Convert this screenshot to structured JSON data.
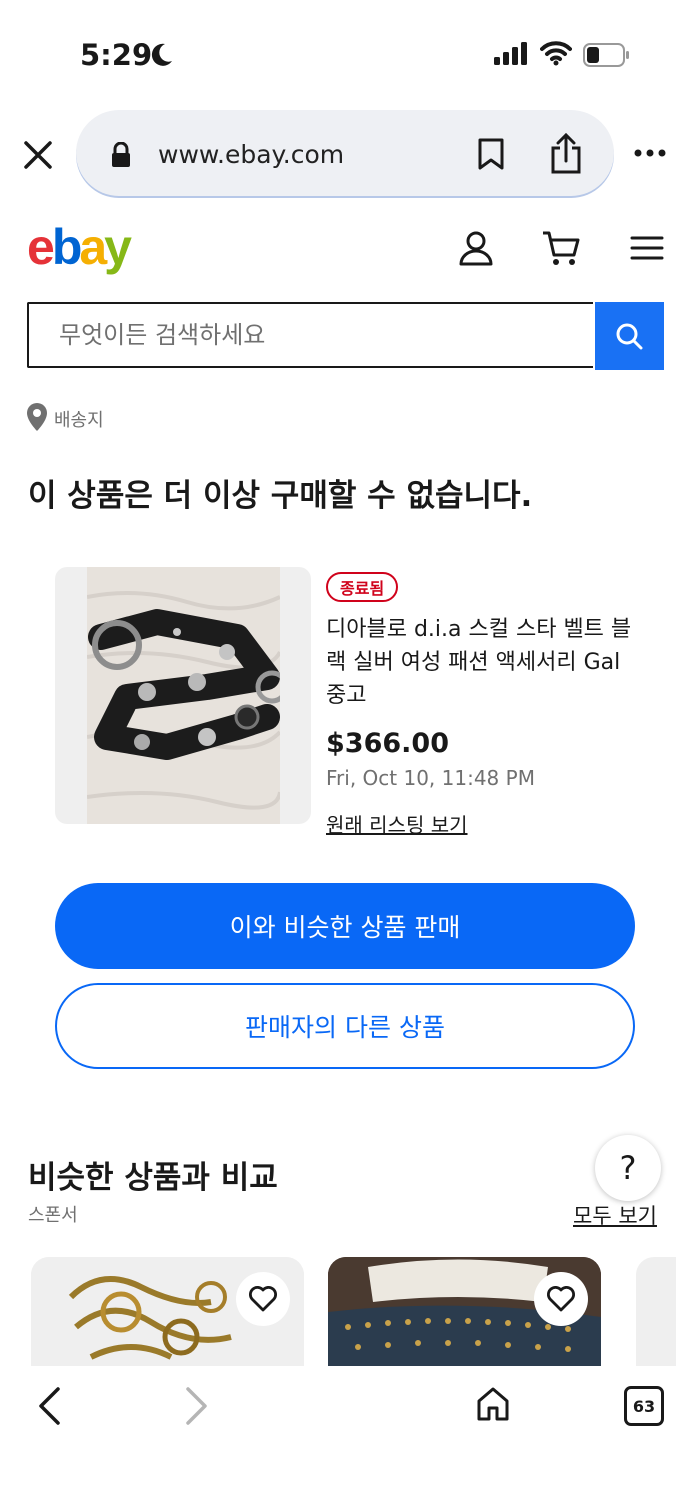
{
  "status_bar": {
    "time": "5:29"
  },
  "browser": {
    "url": "www.ebay.com",
    "tab_count": "63"
  },
  "header": {
    "logo": [
      "e",
      "b",
      "a",
      "y"
    ],
    "logo_colors": [
      "#e53238",
      "#0064d2",
      "#f5af02",
      "#86b817"
    ]
  },
  "search": {
    "placeholder": "무엇이든 검색하세요"
  },
  "location": {
    "label": "배송지"
  },
  "headline": "이 상품은 더 이상 구매할 수 없습니다.",
  "item": {
    "badge": "종료됨",
    "title": "디아블로 d.i.a 스컬 스타 벨트 블랙 실버 여성 패션 액세서리 Gal 중고",
    "price": "$366.00",
    "date": "Fri, Oct 10, 11:48 PM",
    "listing_link": "원래 리스팅 보기"
  },
  "actions": {
    "sell_similar": "이와 비슷한 상품 판매",
    "seller_items": "판매자의 다른 상품"
  },
  "compare": {
    "title": "비슷한 상품과 비교",
    "sponsor": "스폰서",
    "see_all": "모두 보기",
    "help": "?"
  },
  "colors": {
    "accent": "#0968f6",
    "ended": "#d0021b"
  }
}
